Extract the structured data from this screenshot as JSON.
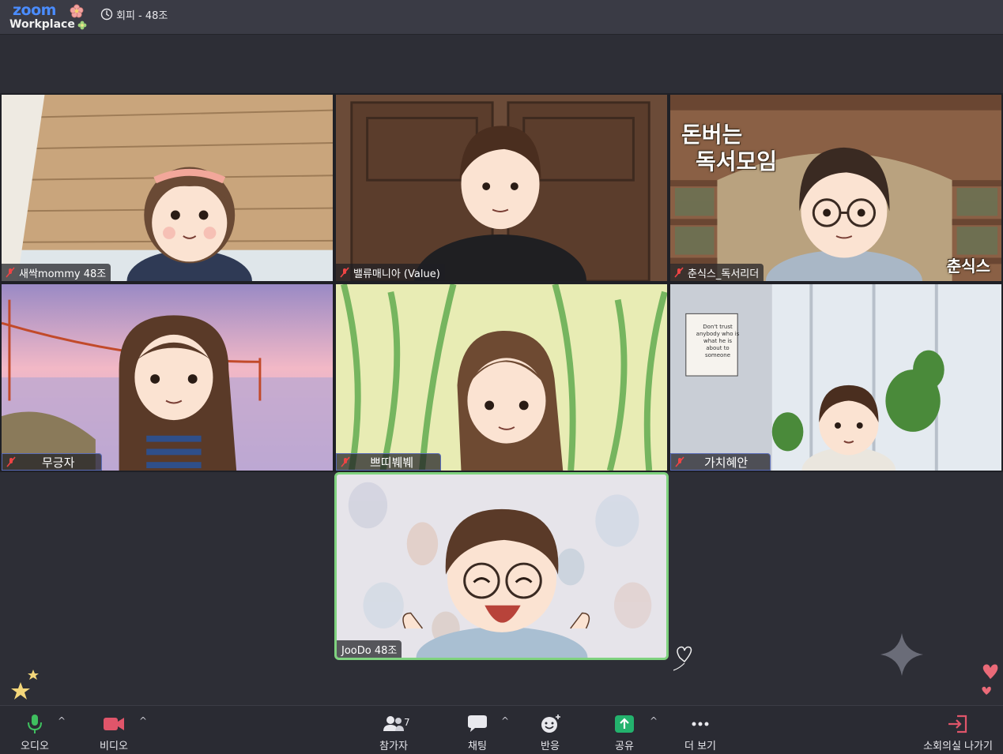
{
  "app": {
    "brand_top": "zoom",
    "brand_bottom": "Workplace",
    "meeting_title": "회피 - 48조"
  },
  "participants": [
    {
      "name": "새싹mommy 48조",
      "muted": true
    },
    {
      "name": "밸류매니아 (Value)",
      "muted": true
    },
    {
      "name": "춘식스_독서리더",
      "muted": true,
      "overlay_main": "돈버는\n독서모임",
      "overlay_line1": "돈버는",
      "overlay_line2": "독서모임",
      "overlay_corner": "춘식스"
    },
    {
      "name": "무긍자",
      "muted": true
    },
    {
      "name": "쁘띠붸붸",
      "muted": true
    },
    {
      "name": "가치혜안",
      "muted": true,
      "note_text": [
        "Don't trust",
        "anybody who is",
        "what he is",
        "about to",
        "someone"
      ]
    },
    {
      "name": "JooDo 48조",
      "muted": false,
      "active_speaker": true
    }
  ],
  "toolbar": {
    "audio": "오디오",
    "video": "비디오",
    "participants": "참가자",
    "participants_count": "7",
    "chat": "채팅",
    "reactions": "반응",
    "share": "공유",
    "more": "더 보기",
    "leave": "소회의실 나가기"
  },
  "colors": {
    "accent": "#4a8cff",
    "active_border": "#7fd27f",
    "share_green": "#23b26d",
    "video_red": "#e0556a",
    "leave_red": "#e0556a"
  }
}
